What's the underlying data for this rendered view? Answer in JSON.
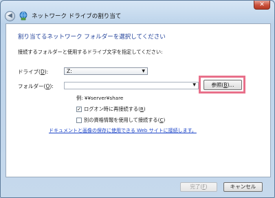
{
  "window": {
    "title": "ネットワーク ドライブの割り当て",
    "close_symbol": "✕"
  },
  "main": {
    "heading": "割り当てるネットワーク フォルダーを選択してください",
    "instruction": "接続するフォルダーと使用するドライブ文字を指定してください:",
    "drive_label_prefix": "ドライブ(",
    "drive_label_key": "D",
    "drive_label_suffix": "):",
    "drive_value": "Z:",
    "folder_label_prefix": "フォルダー(",
    "folder_label_key": "O",
    "folder_label_suffix": "):",
    "folder_value": "",
    "browse_prefix": "参照(",
    "browse_key": "B",
    "browse_suffix": ")...",
    "example": "例: ¥¥server¥share",
    "reconnect_prefix": "ログオン時に再接続する(",
    "reconnect_key": "R",
    "reconnect_suffix": ")",
    "reconnect_checked": true,
    "credentials_prefix": "別の資格情報を使用して接続する(",
    "credentials_key": "C",
    "credentials_suffix": ")",
    "credentials_checked": false,
    "link": "ドキュメントと画像の保存に使用できる Web サイトに接続します。"
  },
  "footer": {
    "finish_prefix": "完了(",
    "finish_key": "F",
    "finish_suffix": ")",
    "cancel": "キャンセル"
  },
  "icons": {
    "back": "back-arrow-icon",
    "network": "network-drive-icon",
    "dropdown": "chevron-down-icon"
  },
  "colors": {
    "heading": "#1f3f99",
    "link": "#1c45c8",
    "highlight": "#e8708a",
    "close": "#c9503b"
  }
}
